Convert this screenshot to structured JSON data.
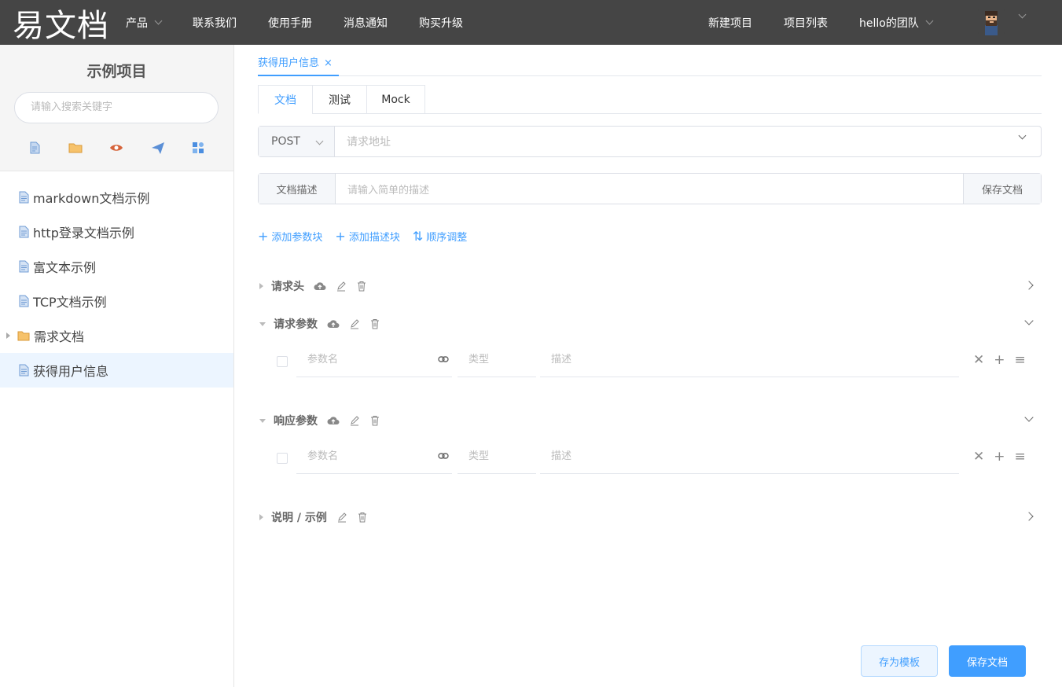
{
  "header": {
    "logo": "易文档",
    "nav": [
      {
        "label": "产品",
        "dropdown": true
      },
      {
        "label": "联系我们"
      },
      {
        "label": "使用手册"
      },
      {
        "label": "消息通知"
      },
      {
        "label": "购买升级"
      }
    ],
    "right": {
      "new_project": "新建项目",
      "project_list": "项目列表",
      "team": "hello的团队"
    }
  },
  "sidebar": {
    "project_title": "示例项目",
    "search_placeholder": "请输入搜索关键字",
    "tools": [
      "file-icon",
      "folder-icon",
      "eye-icon",
      "send-icon",
      "grid-icon"
    ],
    "items": [
      {
        "label": "markdown文档示例",
        "type": "file"
      },
      {
        "label": "http登录文档示例",
        "type": "file"
      },
      {
        "label": "富文本示例",
        "type": "file"
      },
      {
        "label": "TCP文档示例",
        "type": "file"
      },
      {
        "label": "需求文档",
        "type": "folder"
      },
      {
        "label": "获得用户信息",
        "type": "file",
        "active": true
      }
    ]
  },
  "main": {
    "open_tab": "获得用户信息",
    "close_glyph": "×",
    "subtabs": [
      "文档",
      "测试",
      "Mock"
    ],
    "method": "POST",
    "url_placeholder": "请求地址",
    "desc_label": "文档描述",
    "desc_placeholder": "请输入简单的描述",
    "desc_save": "保存文档",
    "actions": [
      {
        "label": "添加参数块",
        "symbol": "+"
      },
      {
        "label": "添加描述块",
        "symbol": "+"
      },
      {
        "label": "顺序调整",
        "symbol": "⇅"
      }
    ],
    "sections": {
      "headers": "请求头",
      "params": "请求参数",
      "response": "响应参数",
      "example": "说明 / 示例"
    },
    "param_row": {
      "name_placeholder": "参数名",
      "type_placeholder": "类型",
      "desc_placeholder": "描述",
      "remove": "✕",
      "add": "+",
      "menu": "≡"
    },
    "buttons": {
      "save_template": "存为模板",
      "save_doc": "保存文档"
    }
  },
  "colors": {
    "accent": "#409eff",
    "topbar": "#454545"
  }
}
